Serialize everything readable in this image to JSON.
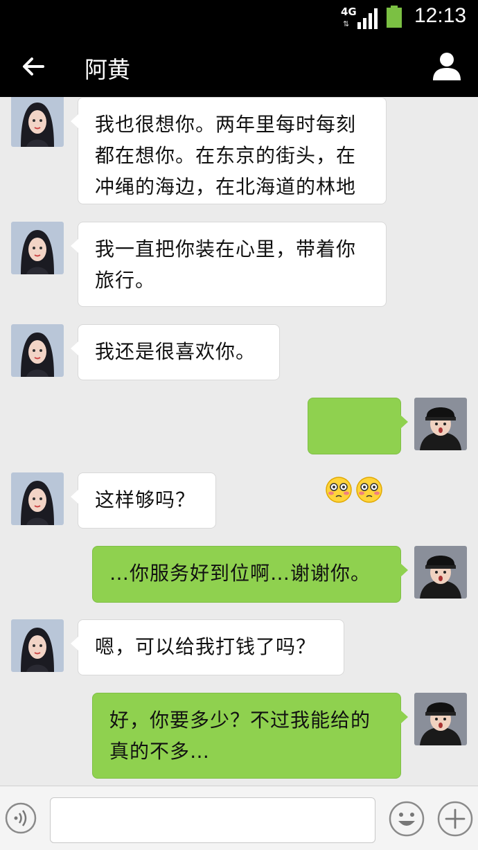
{
  "status_bar": {
    "network": "4G",
    "time": "12:13",
    "signal_icon": "signal-icon",
    "battery_icon": "battery-icon",
    "battery_color": "#7bc043"
  },
  "header": {
    "title": "阿黄",
    "back_icon": "back-arrow-icon",
    "contact_icon": "contact-profile-icon"
  },
  "colors": {
    "incoming_bubble": "#ffffff",
    "outgoing_bubble": "#8fd14f",
    "chat_background": "#ebebeb"
  },
  "messages": [
    {
      "sender": "contact",
      "text": "我也很想你。两年里每时每刻\n都在想你。在东京的街头，在\n冲绳的海边，在北海道的林地"
    },
    {
      "sender": "contact",
      "text": "我一直把你装在心里，带着你\n旅行。"
    },
    {
      "sender": "contact",
      "text": "我还是很喜欢你。"
    },
    {
      "sender": "me",
      "text": "",
      "emoji": [
        "flushed-face-icon",
        "flushed-face-icon"
      ]
    },
    {
      "sender": "contact",
      "text": "这样够吗？"
    },
    {
      "sender": "me",
      "text": "…你服务好到位啊…谢谢你。"
    },
    {
      "sender": "contact",
      "text": "嗯，可以给我打钱了吗？"
    },
    {
      "sender": "me",
      "text": "好，你要多少？不过我能给的\n真的不多…"
    }
  ],
  "input_bar": {
    "voice_icon": "voice-toggle-icon",
    "placeholder": "",
    "emoji_icon": "emoji-smile-icon",
    "plus_icon": "plus-icon"
  }
}
